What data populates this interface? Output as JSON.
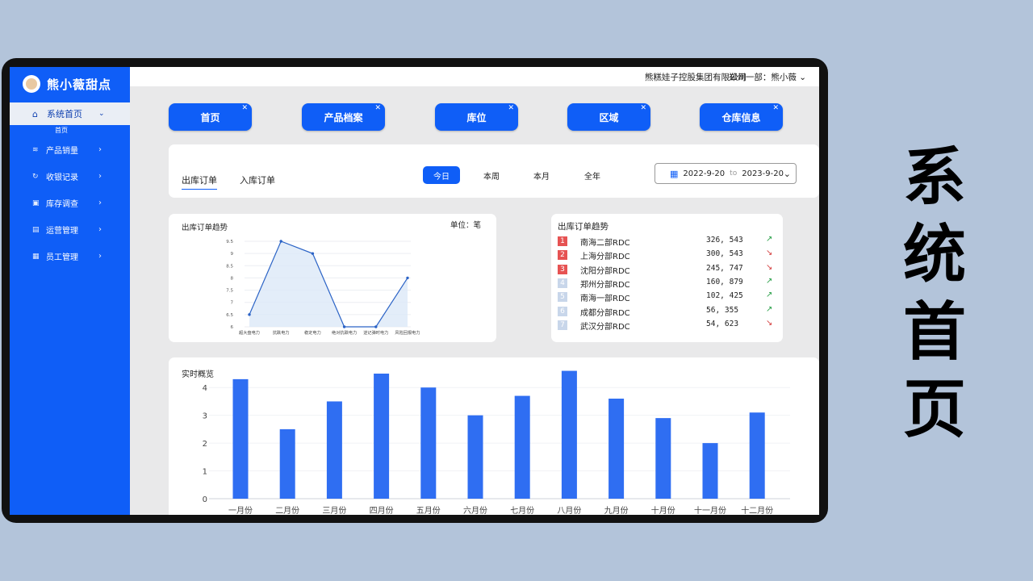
{
  "app": {
    "name": "熊小薇甜点",
    "company": "熊糕娃子控股集团有限公司",
    "user": "郑州一部：熊小薇"
  },
  "sidebar": {
    "active": {
      "label": "系统首页",
      "sub": "首页"
    },
    "items": [
      {
        "label": "产品销量",
        "icon": "layers-icon"
      },
      {
        "label": "收银记录",
        "icon": "refresh-icon"
      },
      {
        "label": "库存调查",
        "icon": "box-icon"
      },
      {
        "label": "运营管理",
        "icon": "chart-window-icon"
      },
      {
        "label": "员工管理",
        "icon": "user-card-icon"
      }
    ]
  },
  "tabs": [
    "首页",
    "产品档案",
    "库位",
    "区域",
    "仓库信息"
  ],
  "filter": {
    "order_tabs": [
      "出库订单",
      "入库订单"
    ],
    "ranges": [
      "今日",
      "本周",
      "本月",
      "全年"
    ],
    "date_from": "2022-9-20",
    "date_to": "2023-9-20",
    "to_label": "to"
  },
  "line_card": {
    "title": "出库订单趋势",
    "unit": "单位：笔"
  },
  "rank_card": {
    "title": "出库订单趋势",
    "rows": [
      {
        "rank": "1",
        "name": "南海二部RDC",
        "value": "326, 543",
        "trend": "up"
      },
      {
        "rank": "2",
        "name": "上海分部RDC",
        "value": "300, 543",
        "trend": "down"
      },
      {
        "rank": "3",
        "name": "沈阳分部RDC",
        "value": "245, 747",
        "trend": "down"
      },
      {
        "rank": "4",
        "name": "郑州分部RDC",
        "value": "160, 879",
        "trend": "up"
      },
      {
        "rank": "5",
        "name": "南海一部RDC",
        "value": "102, 425",
        "trend": "up"
      },
      {
        "rank": "6",
        "name": "成都分部RDC",
        "value": "56, 355",
        "trend": "up"
      },
      {
        "rank": "7",
        "name": "武汉分部RDC",
        "value": "54, 623",
        "trend": "down"
      }
    ],
    "colors": {
      "top": "#e65353",
      "rest": "#c8d6ea",
      "up": "#2aa049",
      "down": "#d43c3c"
    }
  },
  "bottom_card": {
    "title": "实时概览"
  },
  "side_title": "系统首页",
  "colors": {
    "primary": "#0f5ef7",
    "bar": "#2f6ef2"
  },
  "chart_data": [
    {
      "type": "area",
      "title": "出库订单趋势",
      "categories": [
        "超大盘电力",
        "抗跌电力",
        "稳定电力",
        "绝对抗跌电力",
        "逆记弹时电力",
        "风险回报电力"
      ],
      "values": [
        6.5,
        9.5,
        9.0,
        6.0,
        6.0,
        8.0
      ],
      "ylim": [
        6,
        9.5
      ],
      "yticks": [
        "9.5",
        "9",
        "8.5",
        "8",
        "7.5",
        "7",
        "6.5",
        "6"
      ]
    },
    {
      "type": "bar",
      "title": "实时概览",
      "categories": [
        "一月份",
        "二月份",
        "三月份",
        "四月份",
        "五月份",
        "六月份",
        "七月份",
        "八月份",
        "九月份",
        "十月份",
        "十一月份",
        "十二月份"
      ],
      "values": [
        4.3,
        2.5,
        3.5,
        4.5,
        4.0,
        3.0,
        3.7,
        4.6,
        3.6,
        2.9,
        2.0,
        3.1
      ],
      "ylim": [
        0,
        4.5
      ],
      "yticks": [
        "4",
        "3",
        "2",
        "1",
        "0"
      ]
    }
  ]
}
